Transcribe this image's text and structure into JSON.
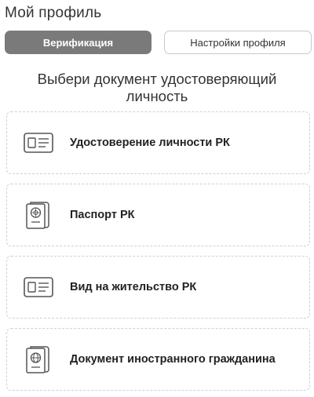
{
  "header": {
    "title": "Мой профиль"
  },
  "tabs": [
    {
      "label": "Верификация",
      "active": true
    },
    {
      "label": "Настройки профиля",
      "active": false
    }
  ],
  "main": {
    "heading_line1": "Выбери документ удостоверяющий",
    "heading_line2": "личность",
    "documents": [
      {
        "label": "Удостоверение личности РК",
        "icon": "id-card-icon"
      },
      {
        "label": "Паспорт РК",
        "icon": "passport-emblem-icon"
      },
      {
        "label": "Вид на жительство РК",
        "icon": "residence-card-icon"
      },
      {
        "label": "Документ иностранного гражданина",
        "icon": "passport-globe-icon"
      }
    ]
  },
  "colors": {
    "tab_active_bg": "#7a7a7a",
    "border": "#cfcfcf",
    "text": "#222222"
  }
}
